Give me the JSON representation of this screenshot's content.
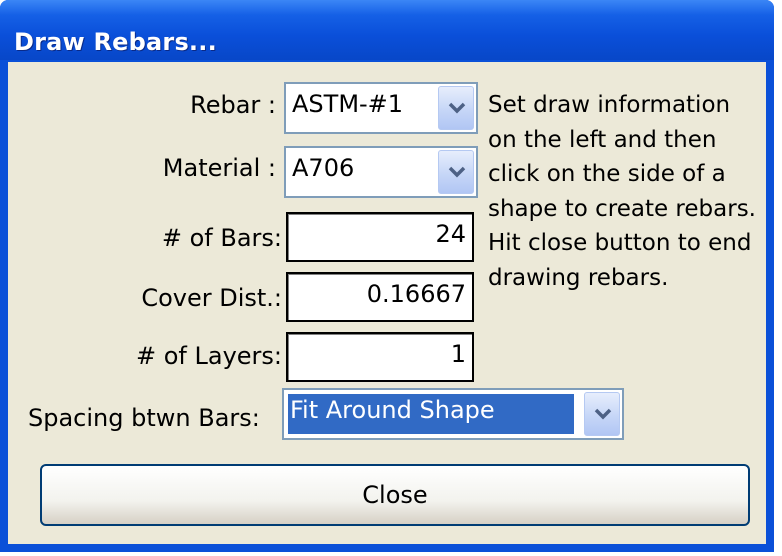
{
  "window": {
    "title": "Draw Rebars..."
  },
  "form": {
    "rebar_label": "Rebar :",
    "rebar_value": "ASTM-#1",
    "material_label": "Material :",
    "material_value": "A706",
    "bars_label": "# of Bars:",
    "bars_value": "24",
    "cover_label": "Cover Dist.:",
    "cover_value": "0.16667",
    "layers_label": "# of Layers:",
    "layers_value": "1",
    "spacing_label": "Spacing btwn Bars:",
    "spacing_value": "Fit Around Shape"
  },
  "info_text": "Set draw information on the left and then click on the side of a shape to create rebars. Hit close button to end drawing rebars.",
  "buttons": {
    "close_label": "Close"
  },
  "icons": {
    "dropdown": "chevron-down-icon"
  },
  "colors": {
    "titlebar": "#0a50d8",
    "client": "#ece9d8",
    "selection": "#316ac5"
  }
}
